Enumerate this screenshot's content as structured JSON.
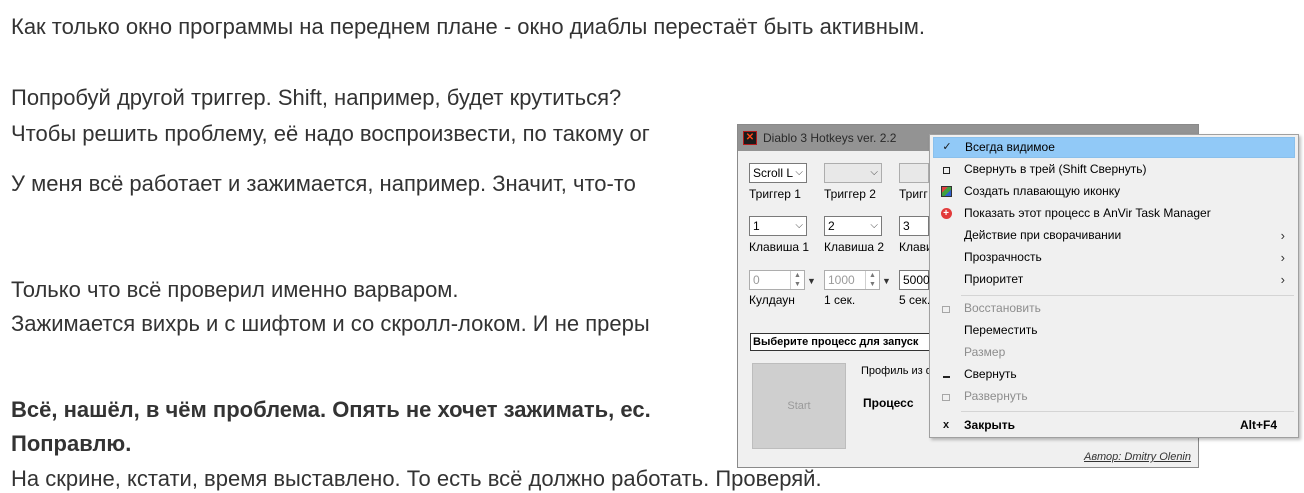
{
  "post": {
    "lines": [
      "Как только окно программы на переднем плане - окно диаблы перестаёт быть активным.",
      "Попробуй другой триггер. Shift, например, будет крутиться?",
      "Чтобы решить проблему, её надо воспроизвести, по такому ог",
      "У меня всё работает и зажимается, например. Значит, что-то",
      "Только что всё проверил именно варваром.",
      "Зажимается вихрь и с шифтом и со скролл-локом. И не преры",
      "Всё, нашёл, в чём проблема. Опять не хочет зажимать, ес.",
      "Поправлю.",
      "На скрине, кстати, время выставлено. То есть всё должно работать. Проверяй."
    ]
  },
  "app": {
    "title": "Diablo 3 Hotkeys ver. 2.2",
    "icon": "diablo-logo-icon",
    "triggers": [
      {
        "value": "Scroll L",
        "label": "Триггер 1"
      },
      {
        "value": "",
        "label": "Триггер 2"
      },
      {
        "value": "",
        "label": "Тригг"
      }
    ],
    "keys": [
      {
        "value": "1",
        "label": "Клавиша 1"
      },
      {
        "value": "2",
        "label": "Клавиша 2"
      },
      {
        "value": "3",
        "label": "Клави"
      }
    ],
    "timers": [
      {
        "value": "0",
        "label": "Кулдаун"
      },
      {
        "value": "1000",
        "label": "1 сек."
      },
      {
        "value": "5000",
        "label": "5 сек."
      }
    ],
    "process_select": "Выберите процесс для запуск",
    "start_label": "Start",
    "profile_label": "Профиль из ф",
    "process_label": "Процесс",
    "author": "Автор: Dmitry Olenin"
  },
  "context_menu": {
    "items": [
      {
        "label": "Всегда видимое",
        "icon": "check-icon"
      },
      {
        "label": "Свернуть в трей (Shift Свернуть)",
        "icon": "tray-icon"
      },
      {
        "label": "Создать плавающую иконку",
        "icon": "floating-icon"
      },
      {
        "label": "Показать этот процесс в AnVir Task Manager",
        "icon": "anvir-icon"
      },
      {
        "label": "Действие при сворачивании",
        "icon": "submenu-arrow-icon"
      },
      {
        "label": "Прозрачность",
        "icon": "submenu-arrow-icon"
      },
      {
        "label": "Приоритет",
        "icon": "submenu-arrow-icon"
      },
      {
        "label": "Восстановить",
        "icon": "restore-icon"
      },
      {
        "label": "Переместить",
        "icon": ""
      },
      {
        "label": "Размер",
        "icon": ""
      },
      {
        "label": "Свернуть",
        "icon": "minimize-icon"
      },
      {
        "label": "Развернуть",
        "icon": "maximize-icon"
      },
      {
        "label": "Закрыть",
        "icon": "close-icon",
        "shortcut": "Alt+F4"
      }
    ],
    "highlight_color": "#91c9f7"
  }
}
